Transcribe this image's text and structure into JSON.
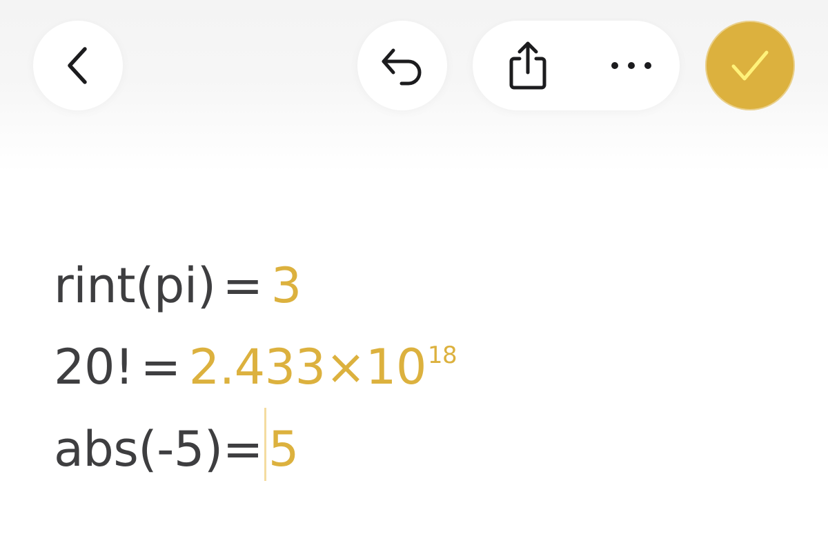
{
  "colors": {
    "accent": "#dcb13e",
    "accent_check": "#fff27a",
    "text": "#3e3e40",
    "cursor": "#f4dca0",
    "icon": "#1c1c1e"
  },
  "toolbar": {
    "back_icon": "chevron-left-icon",
    "undo_icon": "undo-icon",
    "share_icon": "share-icon",
    "more_icon": "ellipsis-icon",
    "done_icon": "checkmark-icon"
  },
  "note": {
    "lines": [
      {
        "expression": "rint(pi)",
        "equals": "=",
        "result": "3",
        "exponent": ""
      },
      {
        "expression": "20!",
        "equals": "=",
        "result": "2.433×10",
        "exponent": "18"
      },
      {
        "expression": "abs(-5)",
        "equals": "=",
        "result": "5",
        "exponent": ""
      }
    ]
  }
}
